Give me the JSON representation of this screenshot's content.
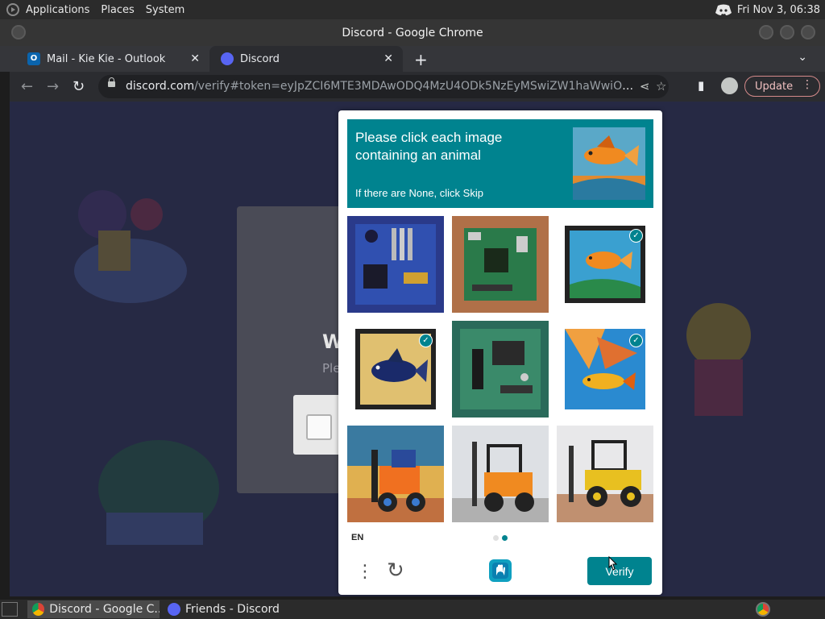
{
  "panel": {
    "menus": [
      "Applications",
      "Places",
      "System"
    ],
    "clock": "Fri Nov 3, 06:38"
  },
  "window": {
    "title": "Discord - Google Chrome"
  },
  "tabs": [
    {
      "label": "Mail - Kie Kie - Outlook",
      "icon": "outlook-icon"
    },
    {
      "label": "Discord",
      "icon": "discord-icon"
    }
  ],
  "toolbar": {
    "url_host": "discord.com",
    "url_path": "/verify#token=eyJpZCI6MTE3MDAwODQ4MzU4ODk5NzEyMSwiZW1haWwiOiJseWVy...",
    "update_label": "Update"
  },
  "page": {
    "heading_partial": "W",
    "sub_partial": "Ple"
  },
  "captcha": {
    "prompt": "Please click each image containing an animal",
    "skip_hint": "If there are None, click Skip",
    "language": "EN",
    "verify_label": "Verify",
    "tiles": [
      {
        "subject": "circuit board",
        "selected": false
      },
      {
        "subject": "circuit board",
        "selected": false
      },
      {
        "subject": "fish painting",
        "selected": true
      },
      {
        "subject": "fish painting",
        "selected": true
      },
      {
        "subject": "circuit board",
        "selected": false
      },
      {
        "subject": "fish painting",
        "selected": true
      },
      {
        "subject": "forklift",
        "selected": false
      },
      {
        "subject": "forklift",
        "selected": false
      },
      {
        "subject": "forklift",
        "selected": false
      }
    ]
  },
  "taskbar": {
    "items": [
      "Discord - Google C...",
      "Friends - Discord"
    ]
  },
  "colors": {
    "captcha_accent": "#00838f",
    "page_bg": "#262944"
  }
}
